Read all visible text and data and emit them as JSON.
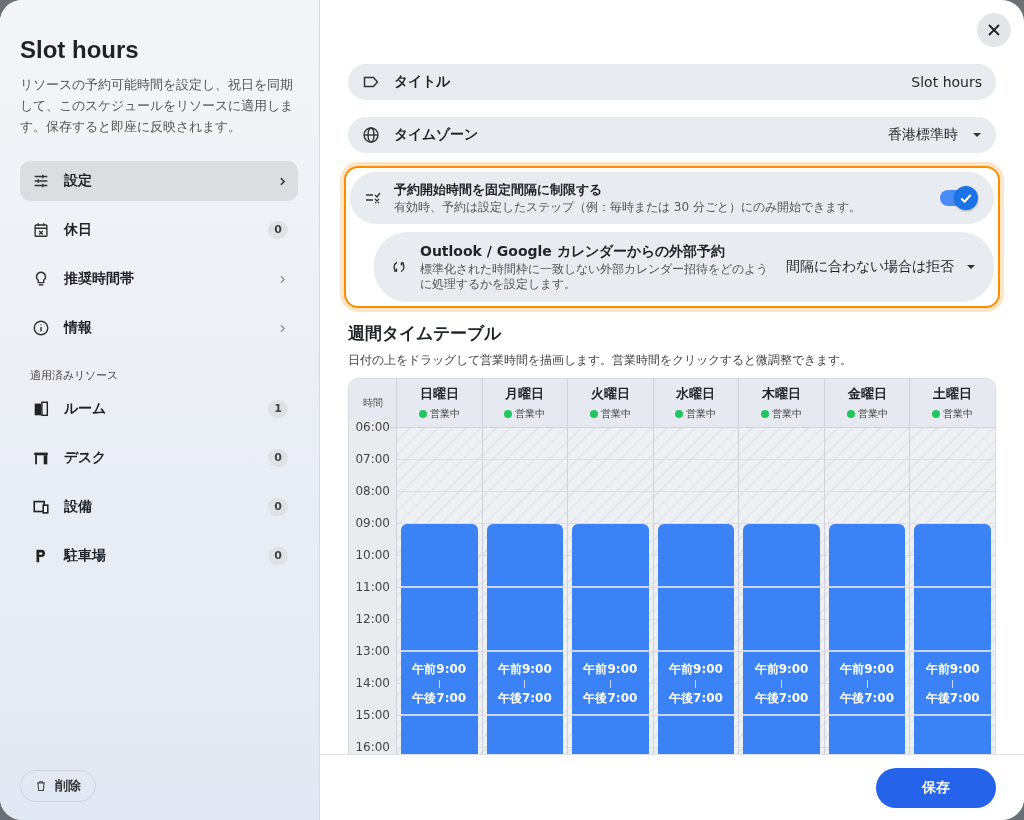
{
  "sidebar": {
    "title": "Slot hours",
    "description": "リソースの予約可能時間を設定し、祝日を同期して、このスケジュールをリソースに適用します。保存すると即座に反映されます。",
    "items": [
      {
        "kind": "settings",
        "label": "設定",
        "selected": true
      },
      {
        "kind": "holiday",
        "label": "休日",
        "count": "0",
        "selected": false
      },
      {
        "kind": "bulb",
        "label": "推奨時間帯",
        "selected": false
      },
      {
        "kind": "info",
        "label": "情報",
        "selected": false
      }
    ],
    "resources_heading": "適用済みリソース",
    "resources": [
      {
        "kind": "room",
        "label": "ルーム",
        "count": "1"
      },
      {
        "kind": "desk",
        "label": "デスク",
        "count": "0"
      },
      {
        "kind": "equipment",
        "label": "設備",
        "count": "0"
      },
      {
        "kind": "parking",
        "label": "駐車場",
        "count": "0"
      }
    ],
    "delete_button": "削除"
  },
  "form": {
    "title_field": {
      "label": "タイトル",
      "value": "Slot hours"
    },
    "timezone_field": {
      "label": "タイムゾーン",
      "value": "香港標準時"
    },
    "fixed_interval": {
      "label": "予約開始時間を固定間隔に制限する",
      "description": "有効時、予約は設定したステップ（例：毎時または 30 分ごと）にのみ開始できます。",
      "on": true
    },
    "external": {
      "label": "Outlook / Google カレンダーからの外部予約",
      "description": "標準化された時間枠に一致しない外部カレンダー招待をどのように処理するかを設定します。",
      "value": "間隔に合わない場合は拒否"
    }
  },
  "timetable": {
    "title": "週間タイムテーブル",
    "description": "日付の上をドラッグして営業時間を描画します。営業時間をクリックすると微調整できます。",
    "time_header": "時間",
    "times": [
      "06:00",
      "07:00",
      "08:00",
      "09:00",
      "10:00",
      "11:00",
      "12:00",
      "13:00",
      "14:00",
      "15:00",
      "16:00"
    ],
    "days": [
      {
        "name": "日曜日",
        "status": "営業中",
        "color": "#22c55e",
        "start": "午前9:00",
        "end": "午後7:00"
      },
      {
        "name": "月曜日",
        "status": "営業中",
        "color": "#22c55e",
        "start": "午前9:00",
        "end": "午後7:00"
      },
      {
        "name": "火曜日",
        "status": "営業中",
        "color": "#22c55e",
        "start": "午前9:00",
        "end": "午後7:00"
      },
      {
        "name": "水曜日",
        "status": "営業中",
        "color": "#22c55e",
        "start": "午前9:00",
        "end": "午後7:00"
      },
      {
        "name": "木曜日",
        "status": "営業中",
        "color": "#22c55e",
        "start": "午前9:00",
        "end": "午後7:00"
      },
      {
        "name": "金曜日",
        "status": "営業中",
        "color": "#22c55e",
        "start": "午前9:00",
        "end": "午後7:00"
      },
      {
        "name": "土曜日",
        "status": "営業中",
        "color": "#22c55e",
        "start": "午前9:00",
        "end": "午後7:00"
      }
    ]
  },
  "save_button": "保存"
}
